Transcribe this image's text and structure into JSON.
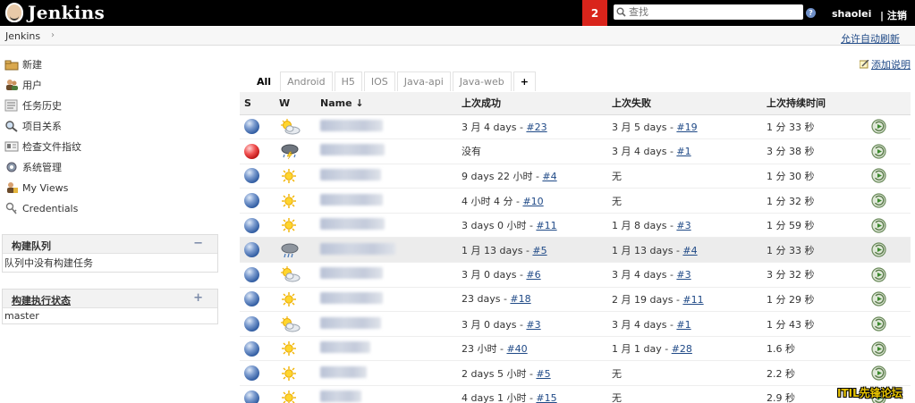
{
  "header": {
    "logo_text": "Jenkins",
    "notification_count": "2",
    "search_placeholder": "查找",
    "help": "?",
    "user": "shaolei",
    "logout": "| 注销"
  },
  "breadcrumb": {
    "root": "Jenkins",
    "separator": "›",
    "auto_refresh": "允许自动刷新"
  },
  "sidebar": {
    "tasks": [
      {
        "label": "新建",
        "icon": "new-job-icon"
      },
      {
        "label": "用户",
        "icon": "users-icon"
      },
      {
        "label": "任务历史",
        "icon": "history-icon"
      },
      {
        "label": "项目关系",
        "icon": "magnifier-icon"
      },
      {
        "label": "检查文件指纹",
        "icon": "fingerprint-icon"
      },
      {
        "label": "系统管理",
        "icon": "gear-icon"
      },
      {
        "label": "My Views",
        "icon": "my-views-icon"
      },
      {
        "label": "Credentials",
        "icon": "credentials-icon"
      }
    ],
    "build_queue": {
      "title": "构建队列",
      "toggle": "−",
      "empty_text": "队列中没有构建任务"
    },
    "executor_status": {
      "title": "构建执行状态",
      "toggle": "+",
      "node": "master"
    }
  },
  "add_description": "添加说明",
  "tabs": [
    "All",
    "Android",
    "H5",
    "IOS",
    "Java-api",
    "Java-web",
    "+"
  ],
  "active_tab": "All",
  "table": {
    "headers": {
      "s": "S",
      "w": "W",
      "name": "Name",
      "sort_arrow": "↓",
      "last_success": "上次成功",
      "last_failure": "上次失败",
      "last_duration": "上次持续时间"
    },
    "rows": [
      {
        "status": "blue",
        "weather": "cloudy",
        "ls_text": "3 月 4 days - ",
        "ls_build": "#23",
        "lf_text": "3 月 5 days - ",
        "lf_build": "#19",
        "duration": "1 分 33 秒"
      },
      {
        "status": "red",
        "weather": "storm",
        "ls_text": "没有",
        "ls_build": "",
        "lf_text": "3 月 4 days - ",
        "lf_build": "#1",
        "duration": "3 分 38 秒"
      },
      {
        "status": "blue",
        "weather": "sunny",
        "ls_text": "9 days 22 小时 - ",
        "ls_build": "#4",
        "lf_text": "无",
        "lf_build": "",
        "duration": "1 分 30 秒"
      },
      {
        "status": "blue",
        "weather": "sunny",
        "ls_text": "4 小时 4 分 - ",
        "ls_build": "#10",
        "lf_text": "无",
        "lf_build": "",
        "duration": "1 分 32 秒"
      },
      {
        "status": "blue",
        "weather": "sunny",
        "ls_text": "3 days 0 小时 - ",
        "ls_build": "#11",
        "lf_text": "1 月 8 days - ",
        "lf_build": "#3",
        "duration": "1 分 59 秒"
      },
      {
        "status": "blue",
        "weather": "rainy",
        "ls_text": "1 月 13 days - ",
        "ls_build": "#5",
        "lf_text": "1 月 13 days - ",
        "lf_build": "#4",
        "duration": "1 分 33 秒"
      },
      {
        "status": "blue",
        "weather": "cloudy",
        "ls_text": "3 月 0 days - ",
        "ls_build": "#6",
        "lf_text": "3 月 4 days - ",
        "lf_build": "#3",
        "duration": "3 分 32 秒"
      },
      {
        "status": "blue",
        "weather": "sunny",
        "ls_text": "23 days - ",
        "ls_build": "#18",
        "lf_text": "2 月 19 days - ",
        "lf_build": "#11",
        "duration": "1 分 29 秒"
      },
      {
        "status": "blue",
        "weather": "cloudy",
        "ls_text": "3 月 0 days - ",
        "ls_build": "#3",
        "lf_text": "3 月 4 days - ",
        "lf_build": "#1",
        "duration": "1 分 43 秒"
      },
      {
        "status": "blue",
        "weather": "sunny",
        "ls_text": "23 小时 - ",
        "ls_build": "#40",
        "lf_text": "1 月 1 day - ",
        "lf_build": "#28",
        "duration": "1.6 秒"
      },
      {
        "status": "blue",
        "weather": "sunny",
        "ls_text": "2 days 5 小时 - ",
        "ls_build": "#5",
        "lf_text": "无",
        "lf_build": "",
        "duration": "2.2 秒"
      },
      {
        "status": "blue",
        "weather": "sunny",
        "ls_text": "4 days 1 小时 - ",
        "ls_build": "#15",
        "lf_text": "无",
        "lf_build": "",
        "duration": "2.9 秒"
      }
    ]
  },
  "watermark": "ITIL先锋论坛",
  "colors": {
    "header_bg": "#000000",
    "notification_bg": "#d9241b",
    "link": "#204a87",
    "highlight_row": "#ececec"
  }
}
